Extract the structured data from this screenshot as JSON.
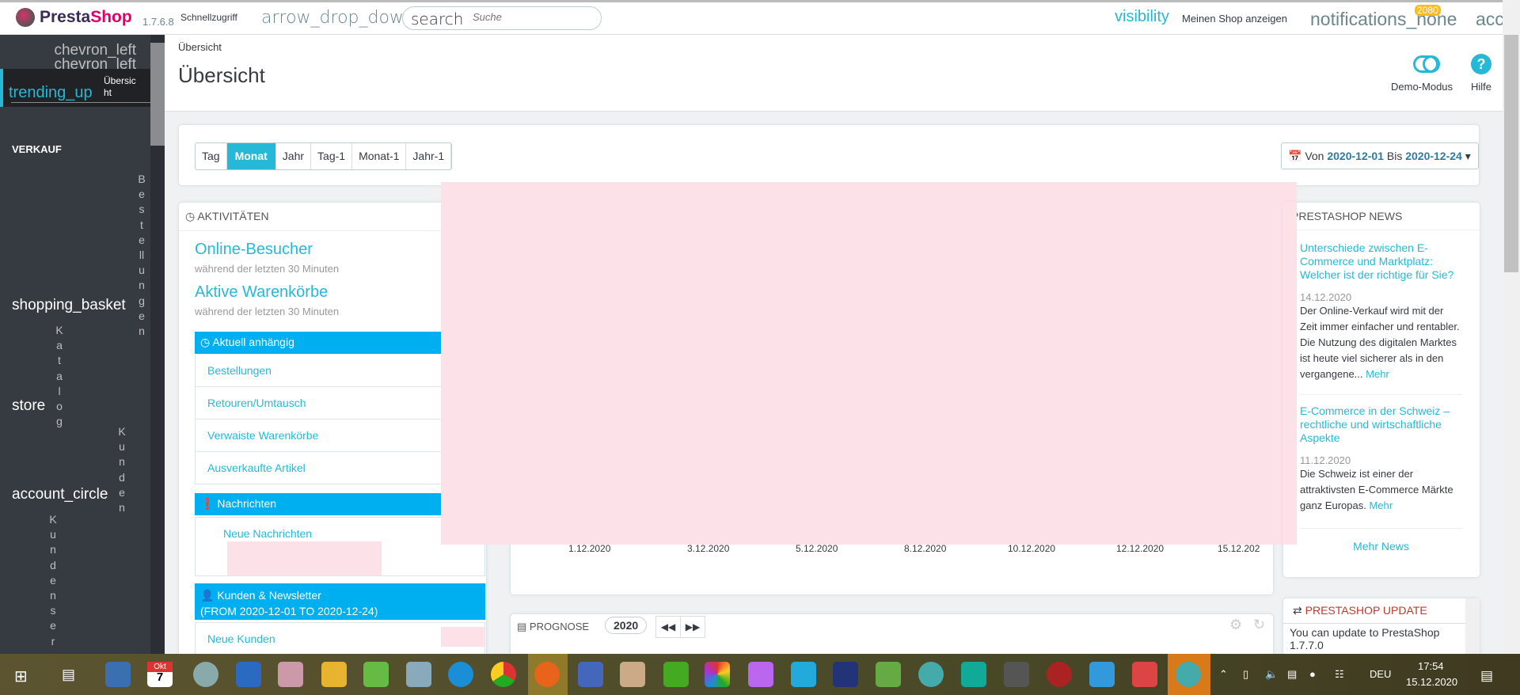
{
  "header": {
    "brand_presta": "Presta",
    "brand_shop": "Shop",
    "version": "1.7.6.8",
    "quick_access": "Schnellzugriff",
    "quick_icon": "arrow_drop_down",
    "search_icon": "search",
    "search_placeholder": "Suche",
    "visibility_icon": "visibility",
    "view_shop": "Meinen Shop anzeigen",
    "notifications_icon": "notifications_none",
    "notifications_count": "2080",
    "account_icon": "acc"
  },
  "sidebar": {
    "collapse1": "chevron_left",
    "collapse2": "chevron_left",
    "active_icon": "trending_up",
    "active_label": "Übersic ht",
    "section": "VERKAUF",
    "items": [
      {
        "icon": "shopping_basket",
        "label": "Bestellungen"
      },
      {
        "icon": "store",
        "label": "Katalog"
      },
      {
        "icon": "account_circle",
        "label": "Kunden"
      },
      {
        "label": "Kundenservi"
      }
    ]
  },
  "page": {
    "breadcrumb": "Übersicht",
    "title": "Übersicht",
    "demo": "Demo-Modus",
    "help": "Hilfe",
    "help_glyph": "?"
  },
  "filter": {
    "buttons": [
      "Tag",
      "Monat",
      "Jahr",
      "Tag-1",
      "Monat-1",
      "Jahr-1"
    ],
    "active": "Monat",
    "von": "Von",
    "from": "2020-12-01",
    "bis": "Bis",
    "to": "2020-12-24"
  },
  "activity": {
    "title": "AKTIVITÄTEN",
    "visitors": "Online-Besucher",
    "visitors_sub": "während der letzten 30 Minuten",
    "carts": "Aktive Warenkörbe",
    "carts_sub": "während der letzten 30 Minuten",
    "pending": "Aktuell anhängig",
    "pending_items": [
      "Bestellungen",
      "Retouren/Umtausch",
      "Verwaiste Warenkörbe",
      "Ausverkaufte Artikel"
    ],
    "messages": "Nachrichten",
    "new_messages": "Neue Nachrichten",
    "customers": "Kunden & Newsletter",
    "customers_range": "(FROM 2020-12-01 TO 2020-12-24)",
    "new_customers": "Neue Kunden"
  },
  "chart": {
    "x_ticks": [
      "1.12.2020",
      "3.12.2020",
      "5.12.2020",
      "8.12.2020",
      "10.12.2020",
      "12.12.2020",
      "15.12.202"
    ]
  },
  "prognose": {
    "title": "PROGNOSE",
    "year": "2020"
  },
  "news": {
    "title": "PRESTASHOP NEWS",
    "items": [
      {
        "title": "Unterschiede zwischen E-Commerce und Marktplatz: Welcher ist der richtige für Sie?",
        "date": "14.12.2020",
        "body": "Der Online-Verkauf wird mit der Zeit immer einfacher und rentabler. Die Nutzung des digitalen Marktes ist heute viel sicherer als in den vergangene...",
        "more": "Mehr"
      },
      {
        "title": "E-Commerce in der Schweiz – rechtliche und wirtschaftliche Aspekte",
        "date": "11.12.2020",
        "body": "Die Schweiz ist einer der attraktivsten E-Commerce Märkte ganz Europas.",
        "more": "Mehr"
      }
    ],
    "more_news": "Mehr News"
  },
  "update": {
    "title": "PRESTASHOP UPDATE",
    "text": "You can update to PrestaShop 1.7.7.0"
  },
  "taskbar": {
    "calendar_month": "Okt",
    "calendar_day": "7",
    "lang": "DEU",
    "time": "17:54",
    "date": "15.12.2020"
  }
}
